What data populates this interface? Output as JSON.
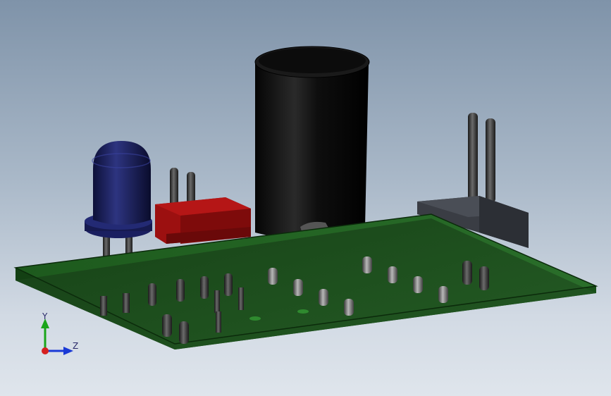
{
  "viewport": {
    "background_top": "#7f93a9",
    "background_bottom": "#dfe5ec"
  },
  "model": {
    "pcb_color": "#1f5a1f",
    "led_color": "#1c1f5a",
    "header_red_color": "#a01212",
    "capacitor_color": "#111111",
    "connector_color": "#3a3d44",
    "pin_color": "#2a2a2a"
  },
  "triad": {
    "y_label": "Y",
    "z_label": "Z",
    "y_color": "#1aa51a",
    "z_color": "#1a3ad6",
    "origin_color": "#d62020",
    "icon": "coordinate-triad-icon"
  }
}
